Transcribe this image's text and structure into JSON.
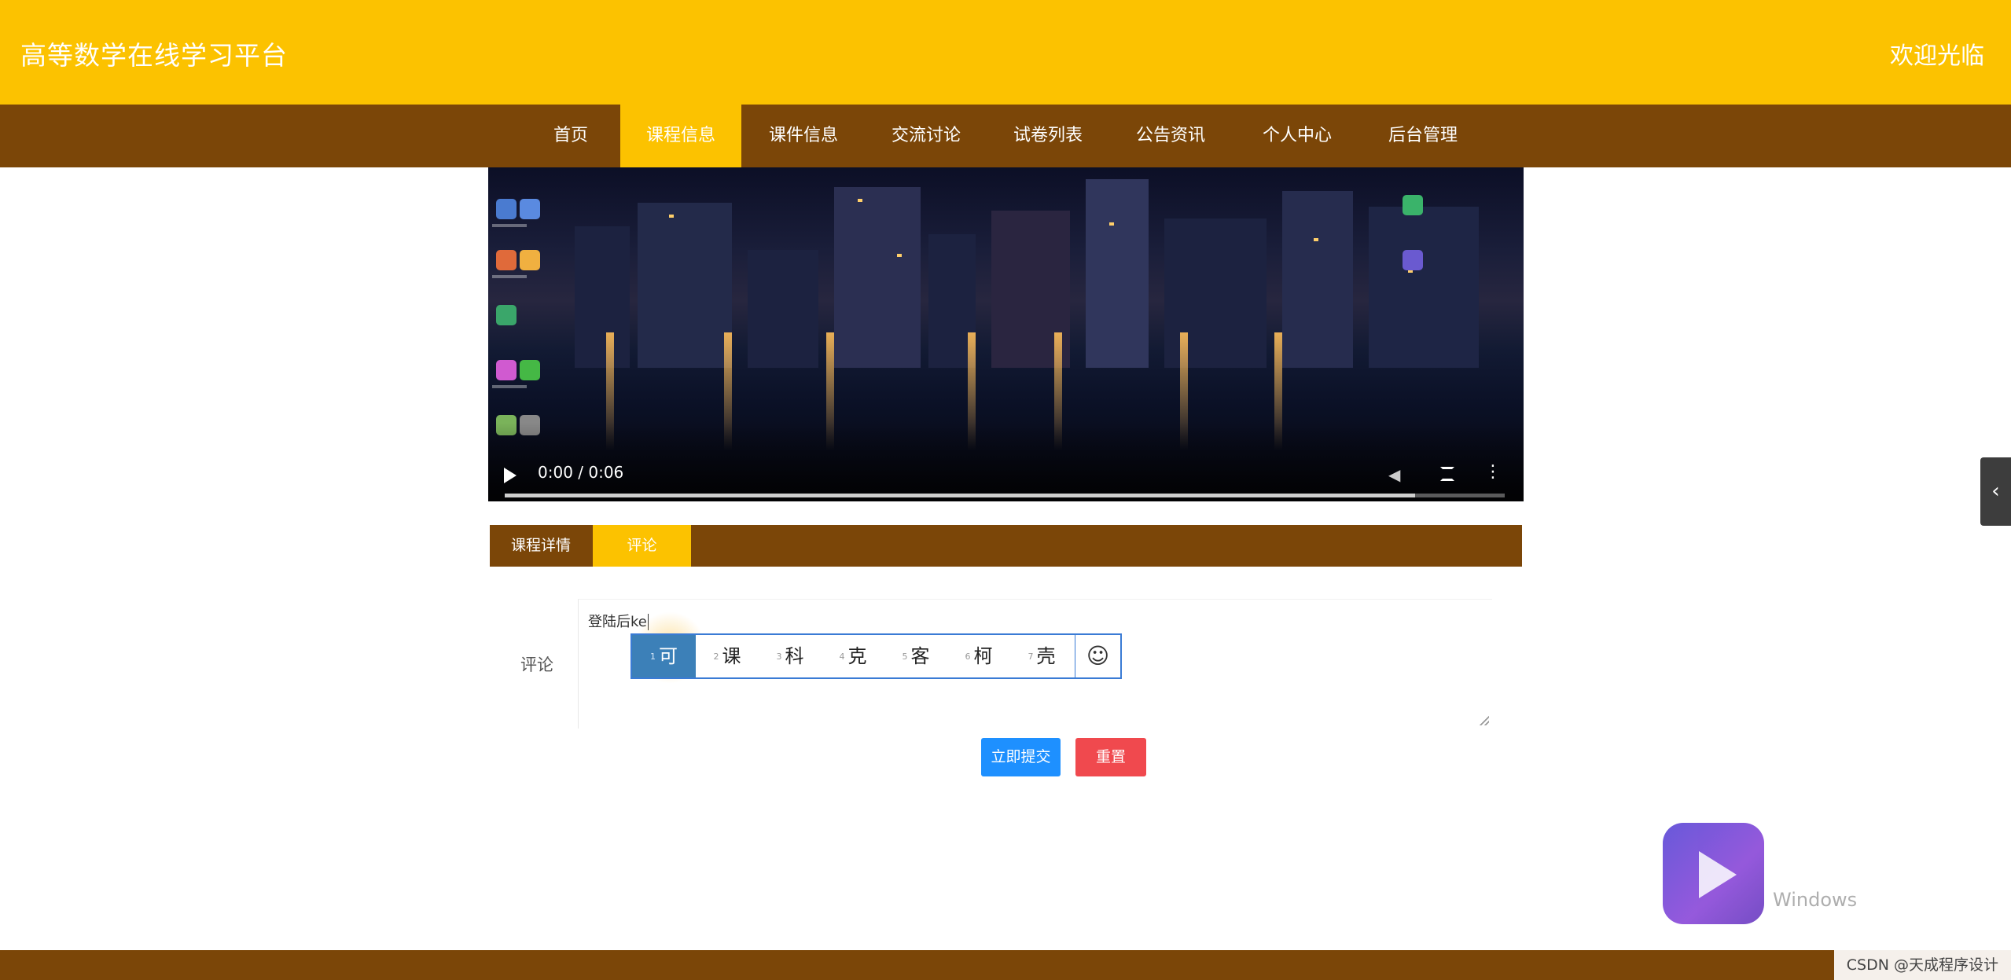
{
  "header": {
    "site_title": "高等数学在线学习平台",
    "welcome": "欢迎光临"
  },
  "nav": {
    "items": [
      "首页",
      "课程信息",
      "课件信息",
      "交流讨论",
      "试卷列表",
      "公告资讯",
      "个人中心",
      "后台管理"
    ],
    "active_index": 1
  },
  "video": {
    "time": "0:00 / 0:06",
    "progress": 0,
    "buffered_fraction": 0.91
  },
  "tabs": {
    "items": [
      "课程详情",
      "评论"
    ],
    "active_index": 1
  },
  "comment_form": {
    "label": "评论",
    "value": "登陆后ke",
    "ime_candidates": [
      "可",
      "课",
      "科",
      "克",
      "客",
      "柯",
      "壳"
    ],
    "ime_active_index": 0,
    "ime_emoji": "☺",
    "submit_label": "立即提交",
    "reset_label": "重置"
  },
  "side_toggle": "‹",
  "overlays": {
    "activate_windows": "Windows",
    "csdn_credit": "CSDN @天成程序设计"
  },
  "colors": {
    "header_bg": "#fcc200",
    "nav_bg": "#7b4608",
    "submit_bg": "#1e90ff",
    "reset_bg": "#f0494e"
  }
}
